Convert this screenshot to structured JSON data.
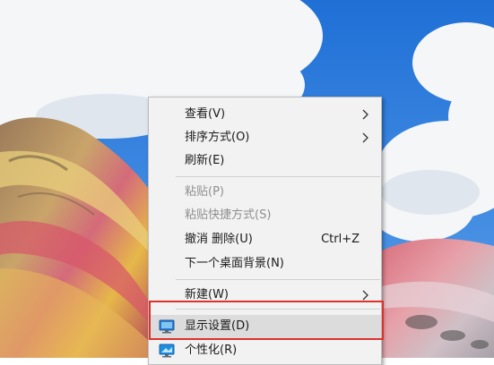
{
  "context_menu": {
    "items": [
      {
        "label": "查看(V)",
        "submenu": true,
        "enabled": true
      },
      {
        "label": "排序方式(O)",
        "submenu": true,
        "enabled": true
      },
      {
        "label": "刷新(E)",
        "enabled": true
      },
      {
        "label": "粘贴(P)",
        "enabled": false
      },
      {
        "label": "粘贴快捷方式(S)",
        "enabled": false
      },
      {
        "label": "撤消 删除(U)",
        "shortcut": "Ctrl+Z",
        "enabled": true
      },
      {
        "label": "下一个桌面背景(N)",
        "enabled": true
      },
      {
        "label": "新建(W)",
        "submenu": true,
        "enabled": true
      },
      {
        "label": "显示设置(D)",
        "icon": "display-icon",
        "enabled": true,
        "highlighted": true
      },
      {
        "label": "个性化(R)",
        "icon": "personalize-icon",
        "enabled": true
      }
    ]
  },
  "colors": {
    "menu_background": "#f2f2f2",
    "highlight_outline": "#e0302a",
    "sky": "#2f7fe0"
  }
}
